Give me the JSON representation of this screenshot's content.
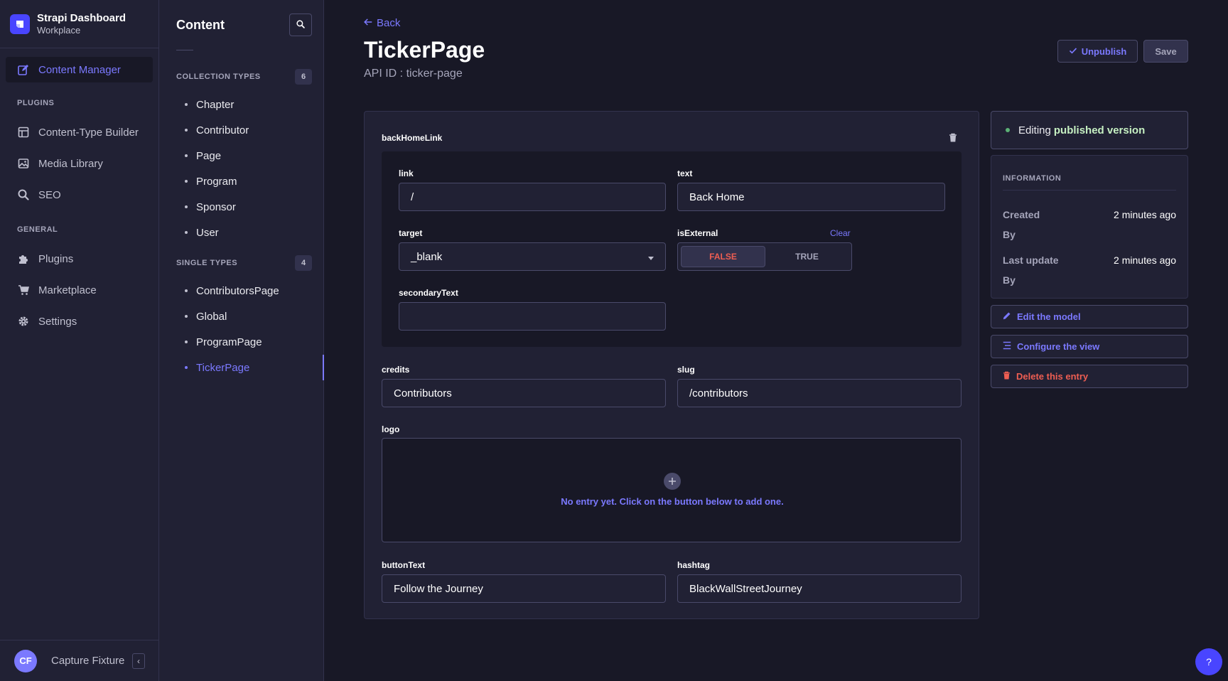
{
  "brand": {
    "title": "Strapi Dashboard",
    "subtitle": "Workplace"
  },
  "nav": {
    "content_manager": "Content Manager",
    "plugins_section": "PLUGINS",
    "plugins": [
      "Content-Type Builder",
      "Media Library",
      "SEO"
    ],
    "general_section": "GENERAL",
    "general": [
      "Plugins",
      "Marketplace",
      "Settings"
    ]
  },
  "user": {
    "initials": "CF",
    "name": "Capture Fixture"
  },
  "subnav": {
    "title": "Content",
    "collection_label": "COLLECTION TYPES",
    "collection_count": "6",
    "collection_items": [
      "Chapter",
      "Contributor",
      "Page",
      "Program",
      "Sponsor",
      "User"
    ],
    "single_label": "SINGLE TYPES",
    "single_count": "4",
    "single_items": [
      "ContributorsPage",
      "Global",
      "ProgramPage",
      "TickerPage"
    ]
  },
  "header": {
    "back": "Back",
    "title": "TickerPage",
    "api_id": "API ID : ticker-page",
    "unpublish": "Unpublish",
    "save": "Save"
  },
  "component": {
    "name": "backHomeLink",
    "link_label": "link",
    "link_value": "/",
    "text_label": "text",
    "text_value": "Back Home",
    "target_label": "target",
    "target_value": "_blank",
    "isexternal_label": "isExternal",
    "clear": "Clear",
    "false_label": "FALSE",
    "true_label": "TRUE",
    "secondary_label": "secondaryText",
    "secondary_value": ""
  },
  "fields": {
    "credits_label": "credits",
    "credits_value": "Contributors",
    "slug_label": "slug",
    "slug_value": "/contributors",
    "logo_label": "logo",
    "logo_empty": "No entry yet. Click on the button below to add one.",
    "buttontext_label": "buttonText",
    "buttontext_value": "Follow the Journey",
    "hashtag_label": "hashtag",
    "hashtag_value": "BlackWallStreetJourney"
  },
  "sidebar": {
    "status_prefix": "Editing",
    "status_strong": "published version",
    "info_heading": "INFORMATION",
    "created_label": "Created",
    "created_value": "2 minutes ago",
    "created_by": "By",
    "updated_label": "Last update",
    "updated_value": "2 minutes ago",
    "updated_by": "By",
    "edit_model": "Edit the model",
    "configure_view": "Configure the view",
    "delete_entry": "Delete this entry"
  },
  "help": "?",
  "colors": {
    "accent": "#7b79ff",
    "primary": "#4945ff",
    "danger": "#ee5e52",
    "success": "#5cb176",
    "background": "#181826",
    "panel": "#212134"
  }
}
